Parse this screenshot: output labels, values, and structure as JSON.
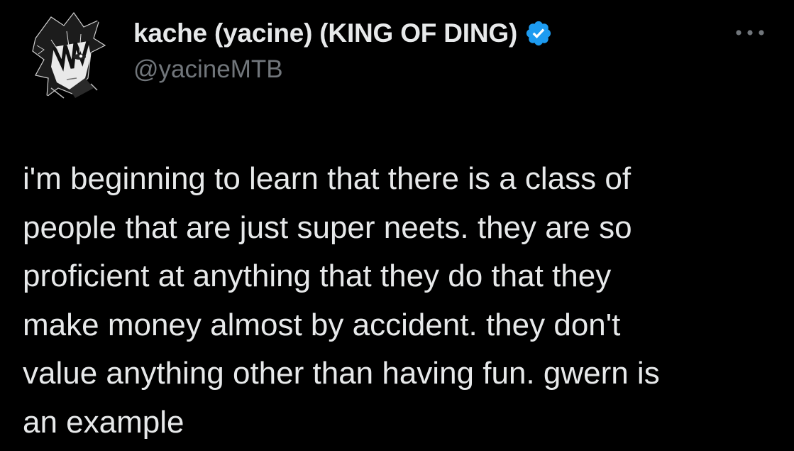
{
  "tweet": {
    "author": {
      "display_name": "kache (yacine) (KING OF DING)",
      "handle": "@yacineMTB",
      "verified": true,
      "verified_icon": "verified-badge-icon",
      "avatar_icon": "anime-avatar",
      "verified_color": "#1d9bf0"
    },
    "more_icon": "more-options-icon",
    "text": "i'm beginning to learn that there is a class of\npeople that are just super neets. they are so\nproficient at anything that they do that they\nmake money almost by accident. they don't\nvalue anything other than having fun. gwern is\nan example"
  },
  "colors": {
    "background": "#000000",
    "primary_text": "#e7e9ea",
    "secondary_text": "#71767b"
  }
}
